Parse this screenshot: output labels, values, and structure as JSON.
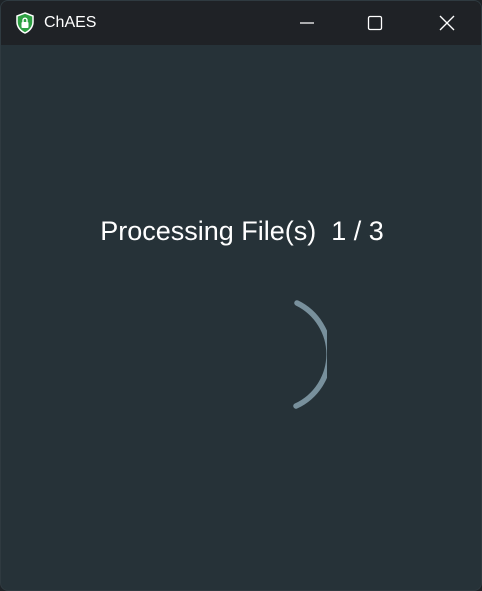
{
  "window": {
    "title": "ChAES",
    "icon": "shield-lock-icon",
    "controls": {
      "minimize": "minimize-icon",
      "maximize": "maximize-icon",
      "close": "close-icon"
    }
  },
  "main": {
    "status_label": "Processing File(s)",
    "progress_text": "1 / 3",
    "spinner": "loading-spinner-icon"
  },
  "colors": {
    "background": "#263238",
    "titlebar": "#1f2226",
    "text": "#ffffff",
    "spinner": "#78909c",
    "icon_green": "#3fb950"
  }
}
